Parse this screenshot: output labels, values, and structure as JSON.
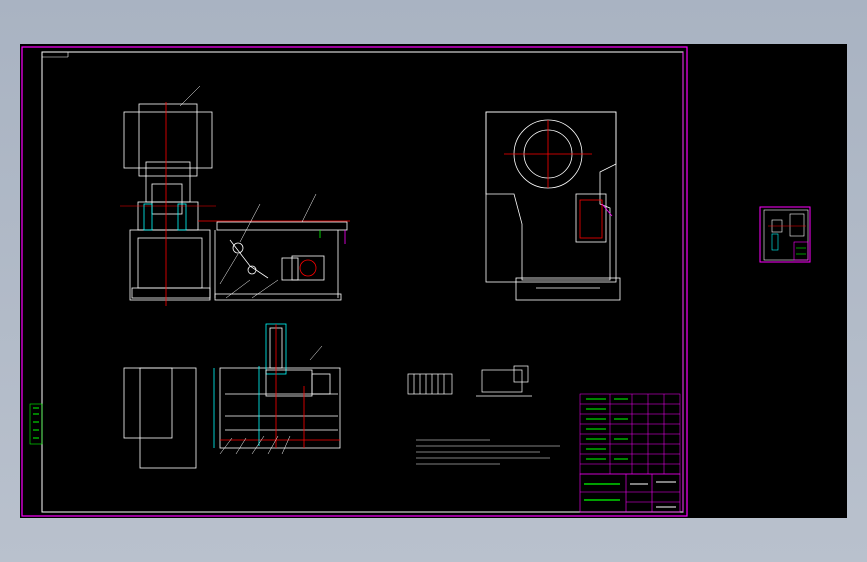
{
  "viewport": {
    "background": "#000000",
    "app_background": "#b0bac8"
  },
  "colors": {
    "frame": "#ff00ff",
    "outline": "#ffffff",
    "centerline": "#ff0000",
    "dimension": "#00ffff",
    "annotation": "#00ff00",
    "hidden": "#0000ff",
    "part": "#ffff00"
  },
  "sheet": {
    "title_block_cells": [
      "",
      "",
      "",
      "",
      ""
    ],
    "note_lines": 3
  }
}
